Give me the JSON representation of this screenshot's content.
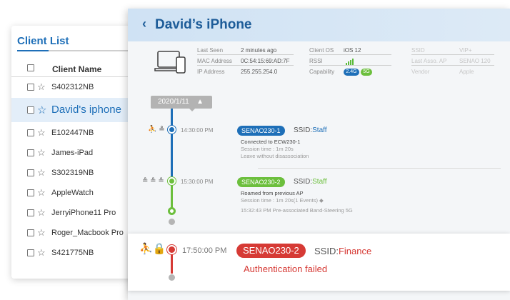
{
  "client_list": {
    "title": "Client List",
    "column_header": "Client Name",
    "clients": [
      {
        "name": "S402312NB"
      },
      {
        "name": "David's iphone",
        "selected": true
      },
      {
        "name": "E102447NB"
      },
      {
        "name": "James-iPad"
      },
      {
        "name": "S302319NB"
      },
      {
        "name": "AppleWatch"
      },
      {
        "name": "JerryiPhone11 Pro"
      },
      {
        "name": "Roger_Macbook Pro"
      },
      {
        "name": "S421775NB"
      }
    ]
  },
  "detail": {
    "back_icon": "chevron-left-icon",
    "title": "David’s iPhone",
    "info": {
      "last_seen_label": "Last Seen",
      "last_seen": "2 minutes ago",
      "mac_label": "MAC Address",
      "mac": "0C:54:15:69:AD:7F",
      "ip_label": "IP Address",
      "ip": "255.255.254.0",
      "os_label": "Client OS",
      "os": "iOS 12",
      "rssi_label": "RSSI",
      "capability_label": "Capability",
      "cap_a": "2.4G",
      "cap_b": "5G",
      "ssid_label": "SSID",
      "ssid": "VIP+",
      "last_ap_label": "Last Asso. AP",
      "last_ap": "SENAO 120",
      "vendor_label": "Vendor",
      "vendor": "Apple"
    },
    "date_tag": "2020/1/11",
    "events": [
      {
        "time": "14:30:00 PM",
        "icons": "⛹ ≗",
        "ap": "SENAO230-1",
        "ssid_prefix": "SSID:",
        "ssid": "Staff",
        "line1": "Connected to ECW230-1",
        "line2": "Session time : 1m 20s",
        "line3": "Leave without disassociation"
      },
      {
        "time": "15:30:00 PM",
        "icons": "≗ ≗ ≗",
        "ap": "SENAO230-2",
        "ssid_prefix": "SSID:",
        "ssid": "Staff",
        "line1": "Roamed from previous AP",
        "line2": "Session time : 1m 20s(1 Events) ◆",
        "line3": "15:32:43 PM   Pre-associated Band-Steering 5G"
      },
      {
        "time": "17:50:00 PM",
        "ap": "SENAO230-2",
        "ssid_prefix": "SSID:",
        "ssid": "Finance",
        "line1": "Authentication failed"
      }
    ]
  },
  "colors": {
    "accent": "#1e6fb8",
    "blue_badge": "#1e6fb8",
    "green": "#6cbf3d",
    "red": "#d63a35"
  }
}
